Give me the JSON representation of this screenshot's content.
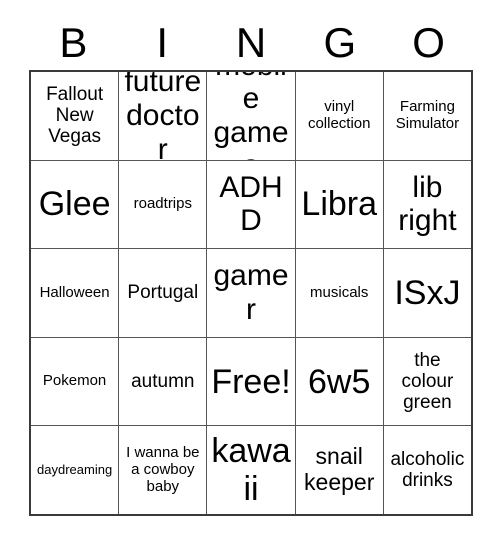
{
  "card": {
    "header_letters": [
      "B",
      "I",
      "N",
      "G",
      "O"
    ],
    "rows": [
      [
        {
          "text": "Fallout New Vegas",
          "size": "md"
        },
        {
          "text": "future doctor",
          "size": "xl"
        },
        {
          "text": "mobile games",
          "size": "xl"
        },
        {
          "text": "vinyl collection",
          "size": "sm"
        },
        {
          "text": "Farming Simulator",
          "size": "sm"
        }
      ],
      [
        {
          "text": "Glee",
          "size": "xxl"
        },
        {
          "text": "roadtrips",
          "size": "sm"
        },
        {
          "text": "ADHD",
          "size": "xl"
        },
        {
          "text": "Libra",
          "size": "xxl"
        },
        {
          "text": "lib right",
          "size": "xl"
        }
      ],
      [
        {
          "text": "Halloween",
          "size": "sm"
        },
        {
          "text": "Portugal",
          "size": "md"
        },
        {
          "text": "gamer",
          "size": "xl"
        },
        {
          "text": "musicals",
          "size": "sm"
        },
        {
          "text": "ISxJ",
          "size": "xxl"
        }
      ],
      [
        {
          "text": "Pokemon",
          "size": "sm"
        },
        {
          "text": "autumn",
          "size": "md"
        },
        {
          "text": "Free!",
          "size": "xxl"
        },
        {
          "text": "6w5",
          "size": "xxl"
        },
        {
          "text": "the colour green",
          "size": "md"
        }
      ],
      [
        {
          "text": "daydreaming",
          "size": "xs"
        },
        {
          "text": "I wanna be a cowboy baby",
          "size": "sm"
        },
        {
          "text": "kawaii",
          "size": "xxl"
        },
        {
          "text": "snail keeper",
          "size": "lg"
        },
        {
          "text": "alcoholic drinks",
          "size": "md"
        }
      ]
    ]
  }
}
